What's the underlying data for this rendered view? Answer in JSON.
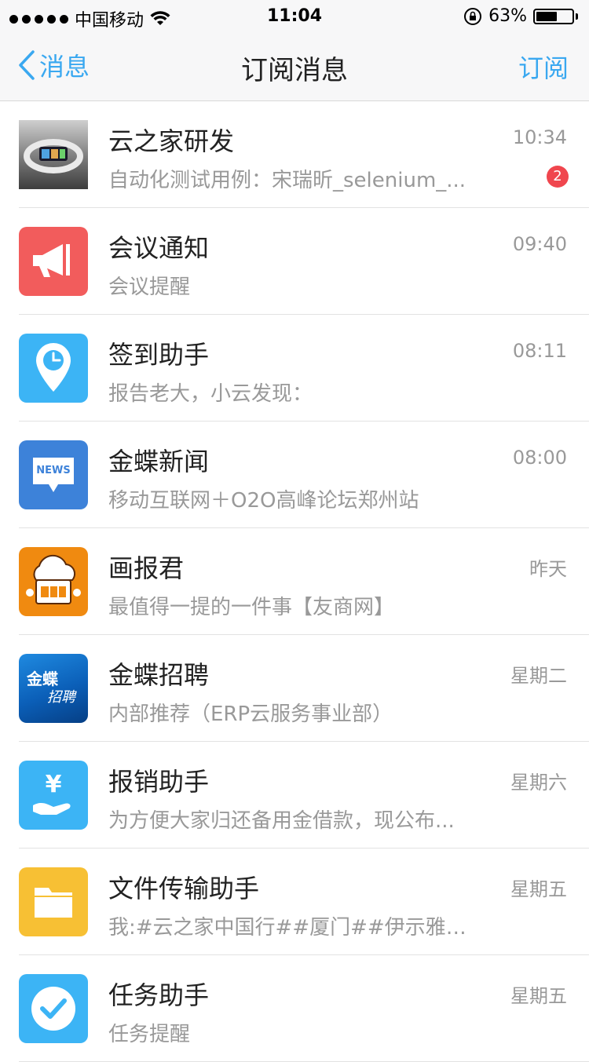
{
  "status_bar": {
    "carrier": "中国移动",
    "time": "11:04",
    "battery_percent": "63%",
    "battery_level": 0.63
  },
  "nav": {
    "back_label": "消息",
    "title": "订阅消息",
    "action_label": "订阅"
  },
  "colors": {
    "accent": "#3aa8f0",
    "badge": "#f0464e"
  },
  "items": [
    {
      "title": "云之家研发",
      "subtitle": "自动化测试用例：宋瑞昕_selenium_...",
      "time": "10:34",
      "badge": "2",
      "icon": "smart-bracelet-image"
    },
    {
      "title": "会议通知",
      "subtitle": "会议提醒",
      "time": "09:40",
      "icon": "megaphone-icon"
    },
    {
      "title": "签到助手",
      "subtitle": "报告老大，小云发现：",
      "time": "08:11",
      "icon": "location-clock-icon"
    },
    {
      "title": "金蝶新闻",
      "subtitle": "移动互联网＋O2O高峰论坛郑州站",
      "time": "08:00",
      "icon": "news-icon",
      "icon_text": "NEWS"
    },
    {
      "title": "画报君",
      "subtitle": "最值得一提的一件事【友商网】",
      "time": "昨天",
      "icon": "pictorial-mascot-icon"
    },
    {
      "title": "金蝶招聘",
      "subtitle": "内部推荐（ERP云服务事业部）",
      "time": "星期二",
      "icon": "recruit-icon",
      "icon_text_1": "金蝶",
      "icon_text_2": "招聘"
    },
    {
      "title": "报销助手",
      "subtitle": "为方便大家归还备用金借款，现公布...",
      "time": "星期六",
      "icon": "yen-hand-icon",
      "icon_text": "¥"
    },
    {
      "title": "文件传输助手",
      "subtitle": "我:#云之家中国行##厦门##伊示雅咖啡#",
      "time": "星期五",
      "icon": "folder-icon"
    },
    {
      "title": "任务助手",
      "subtitle": "任务提醒",
      "time": "星期五",
      "icon": "checkmark-icon"
    }
  ]
}
